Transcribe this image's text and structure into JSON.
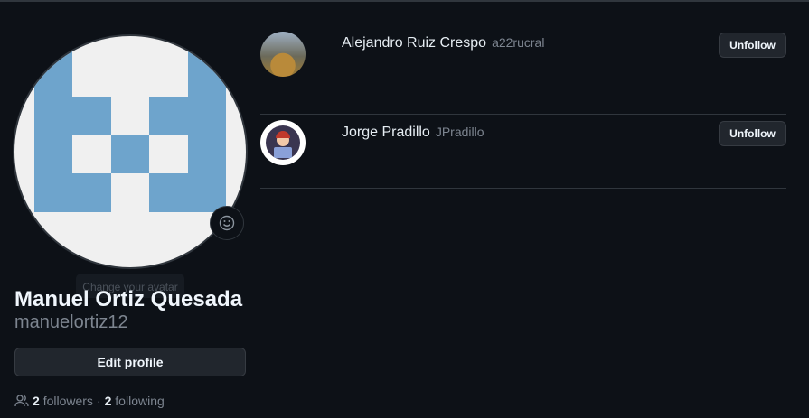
{
  "profile": {
    "name": "Manuel Ortiz Quesada",
    "login": "manuelortiz12",
    "edit_label": "Edit profile",
    "avatar_tooltip": "Change your avatar",
    "followers_count": "2",
    "followers_label": "followers",
    "separator": "·",
    "following_count": "2",
    "following_label": "following"
  },
  "following": [
    {
      "name": "Alejandro Ruiz Crespo",
      "login": "a22rucral",
      "button": "Unfollow"
    },
    {
      "name": "Jorge Pradillo",
      "login": "JPradillo",
      "button": "Unfollow"
    }
  ],
  "colors": {
    "background": "#0d1117",
    "identicon": "#6ea4cc"
  }
}
